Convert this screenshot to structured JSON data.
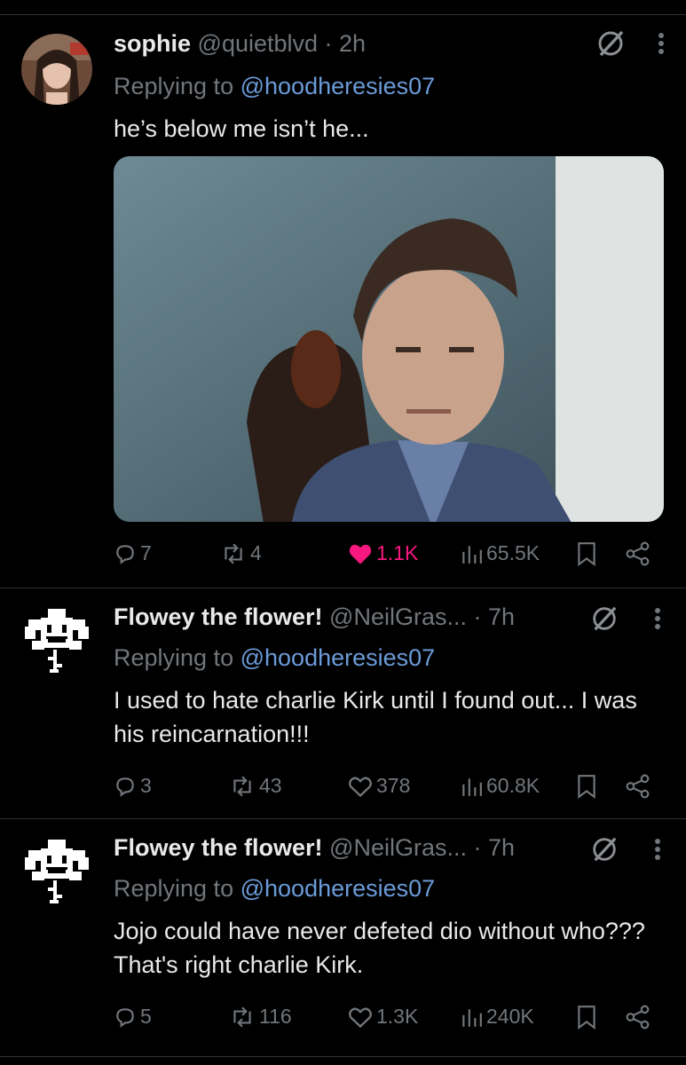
{
  "tweets": [
    {
      "name": "sophie",
      "handle": "@quietblvd",
      "time": "· 2h",
      "replying_prefix": "Replying to",
      "replying_handle": "@hoodheresies07",
      "text": "he’s below me isn’t he...",
      "replies": "7",
      "reposts": "4",
      "likes": "1.1K",
      "views": "65.5K",
      "liked": true
    },
    {
      "name": "Flowey the flower!",
      "handle": "@NeilGras...",
      "time": "· 7h",
      "replying_prefix": "Replying to",
      "replying_handle": "@hoodheresies07",
      "text": "I used to hate charlie Kirk until I found out... I was his reincarnation!!!",
      "replies": "3",
      "reposts": "43",
      "likes": "378",
      "views": "60.8K",
      "liked": false
    },
    {
      "name": "Flowey the flower!",
      "handle": "@NeilGras...",
      "time": "· 7h",
      "replying_prefix": "Replying to",
      "replying_handle": "@hoodheresies07",
      "text": "Jojo could have never defeted dio without who??? That's right charlie Kirk.",
      "replies": "5",
      "reposts": "116",
      "likes": "1.3K",
      "views": "240K",
      "liked": false
    }
  ],
  "colors": {
    "background": "#000000",
    "text": "#e7e9ea",
    "muted": "#71767b",
    "link": "#6b9bd8",
    "like": "#f91880",
    "divider": "#2f3336"
  },
  "icons": [
    "reply-icon",
    "repost-icon",
    "like-icon",
    "views-icon",
    "bookmark-icon",
    "share-icon",
    "grok-icon",
    "more-icon"
  ]
}
